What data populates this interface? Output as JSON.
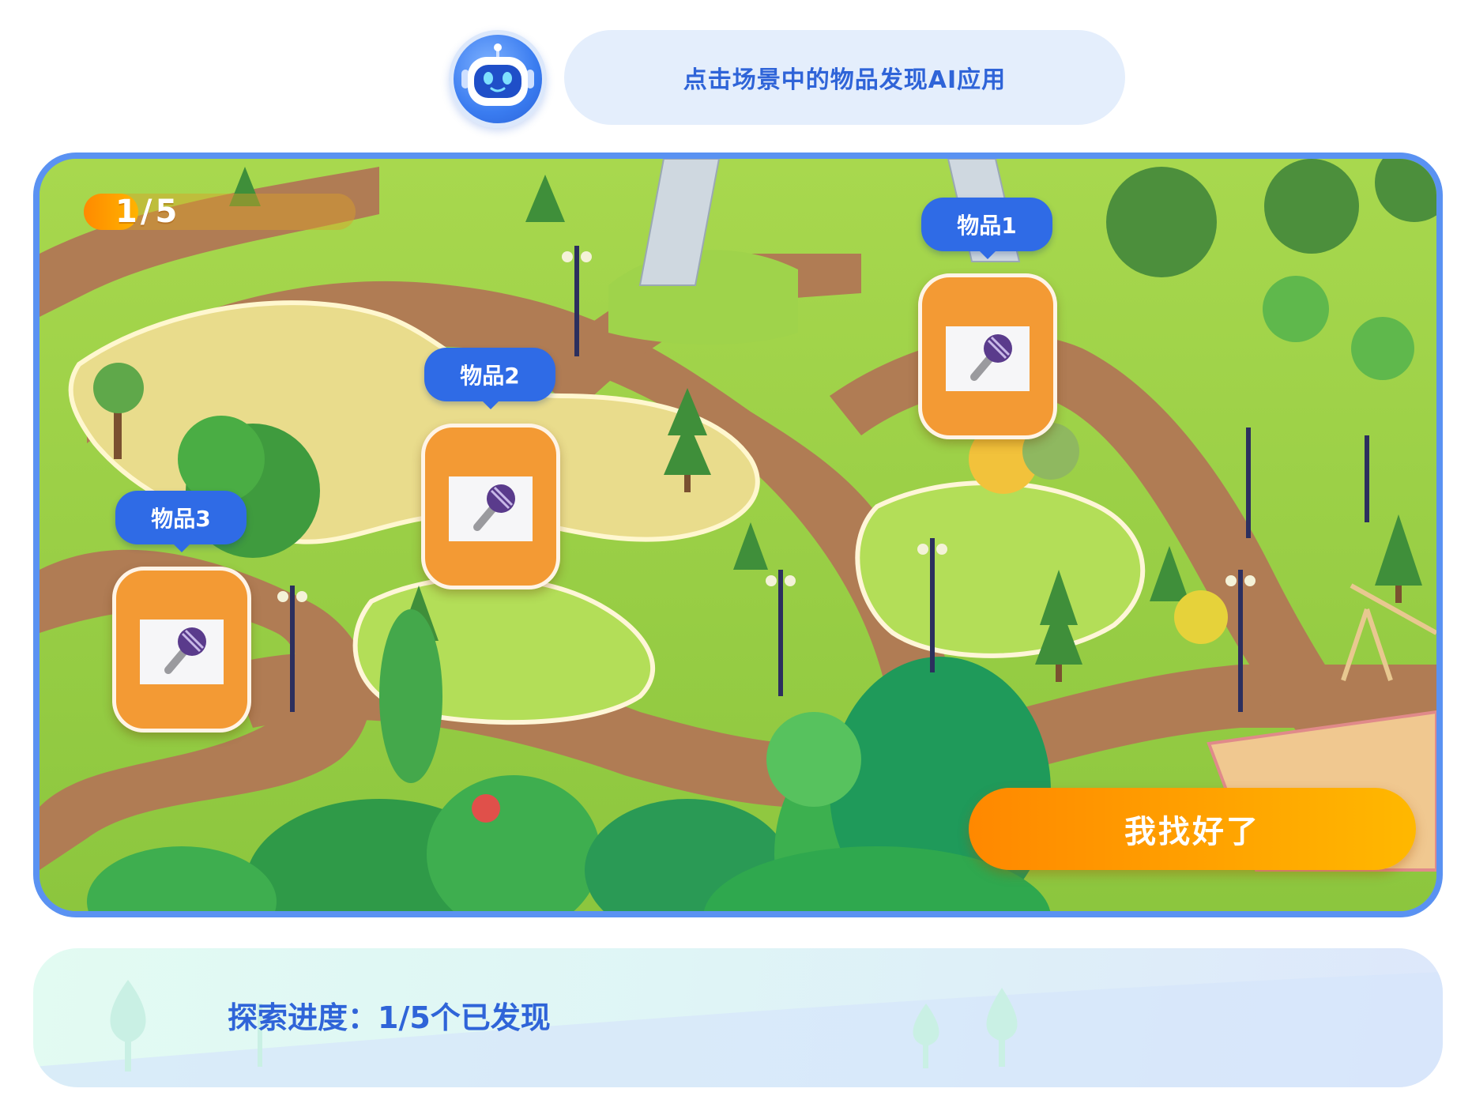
{
  "header": {
    "hint": "点击场景中的物品发现AI应用",
    "avatar_icon": "robot-icon"
  },
  "scene": {
    "progress": {
      "text": "1/5",
      "found": 1,
      "total": 5
    },
    "items": [
      {
        "label": "物品1",
        "icon": "microphone-icon"
      },
      {
        "label": "物品2",
        "icon": "microphone-icon"
      },
      {
        "label": "物品3",
        "icon": "microphone-icon"
      }
    ],
    "done_button": "我找好了"
  },
  "footer": {
    "status": "探索进度：1/5个已发现"
  },
  "colors": {
    "accent_blue": "#2f6be6",
    "card_orange": "#f39a34",
    "button_orange": "#ff8800",
    "frame_blue": "#5a92f2"
  }
}
